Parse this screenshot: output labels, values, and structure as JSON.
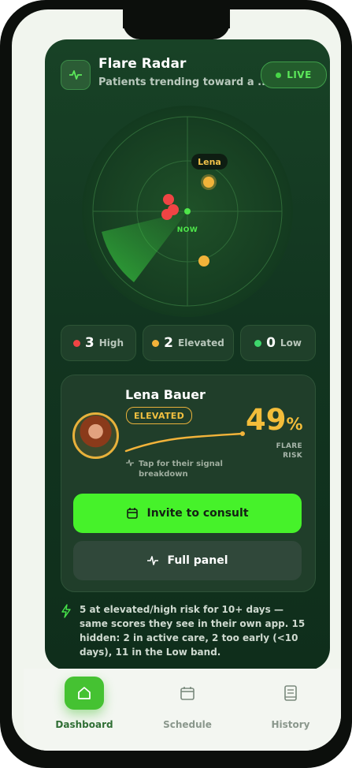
{
  "header": {
    "title": "Flare Radar",
    "subtitle": "Patients trending toward a ...",
    "live_label": "LIVE"
  },
  "radar": {
    "center_label": "NOW",
    "callout_label": "Lena",
    "blips": [
      {
        "level": "high"
      },
      {
        "level": "high"
      },
      {
        "level": "high"
      },
      {
        "level": "elevated",
        "selected": true
      },
      {
        "level": "elevated"
      }
    ]
  },
  "stats": {
    "high": {
      "count": "3",
      "label": "High"
    },
    "elevated": {
      "count": "2",
      "label": "Elevated"
    },
    "low": {
      "count": "0",
      "label": "Low"
    }
  },
  "patient": {
    "name": "Lena Bauer",
    "status": "ELEVATED",
    "risk_value": "49",
    "risk_unit": "%",
    "risk_label_1": "FLARE",
    "risk_label_2": "RISK",
    "hint": "Tap for their signal breakdown",
    "invite_label": "Invite to consult",
    "panel_label": "Full panel"
  },
  "footnote": "5 at elevated/high risk for 10+ days — same scores they see in their own app. 15 hidden: 2 in active care, 2 too early (<10 days), 11 in the Low band.",
  "tabs": [
    {
      "label": "Dashboard",
      "icon": "home-icon",
      "active": true
    },
    {
      "label": "Schedule",
      "icon": "calendar-icon",
      "active": false
    },
    {
      "label": "History",
      "icon": "book-icon",
      "active": false
    }
  ],
  "colors": {
    "accent": "#46f22a",
    "high": "#f04444",
    "elevated": "#f2b33a",
    "low": "#3ed66c",
    "card_bg": "#123520"
  }
}
